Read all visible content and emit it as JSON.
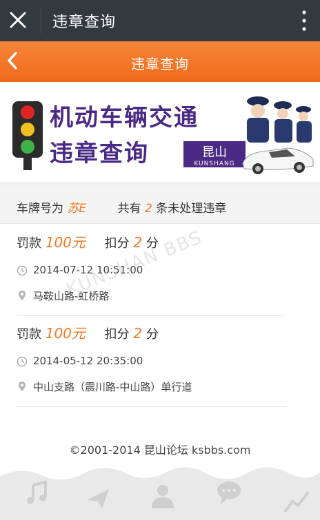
{
  "appbar": {
    "title": "违章查询"
  },
  "header": {
    "title": "违章查询"
  },
  "banner": {
    "line1": "机动车辆交通",
    "line2": "违章查询",
    "badge_cn": "昆山",
    "badge_en": "KUNSHANG"
  },
  "summary": {
    "prefix": "车牌号为",
    "plate": "苏E",
    "middle": "共有",
    "count": "2",
    "suffix": "条未处理违章"
  },
  "records": [
    {
      "fine_label": "罚款",
      "fine": "100元",
      "points_label": "扣分",
      "points": "2",
      "points_unit": "分",
      "time": "2014-07-12 10:51:00",
      "location": "马鞍山路-虹桥路"
    },
    {
      "fine_label": "罚款",
      "fine": "100元",
      "points_label": "扣分",
      "points": "2",
      "points_unit": "分",
      "time": "2014-05-12 20:35:00",
      "location": "中山支路（震川路-中山路）单行道"
    }
  ],
  "watermark": "KUNSHAN BBS",
  "footer": {
    "copyright": "©2001-2014 昆山论坛 ksbbs.com"
  },
  "colors": {
    "accent": "#f27a21",
    "appbar": "#333a3f",
    "banner_text": "#4b2a85"
  },
  "bottom_icons": [
    "music-icon",
    "plane-icon",
    "person-icon",
    "chat-icon",
    "chart-icon"
  ]
}
